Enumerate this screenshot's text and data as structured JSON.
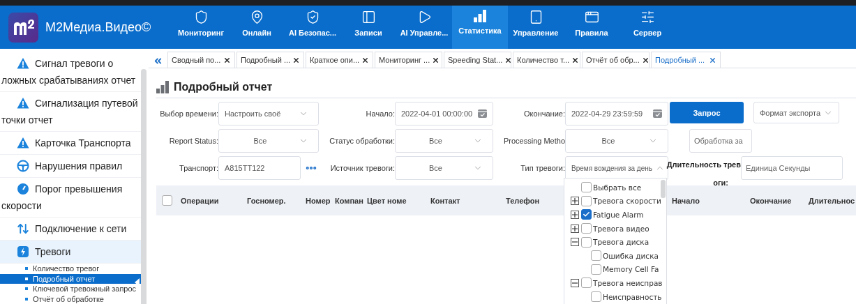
{
  "top_bar": {
    "brand": "M2Медиа.Видео©",
    "nav": [
      {
        "label": "Мониторинг",
        "selected": false
      },
      {
        "label": "Онлайн",
        "selected": false
      },
      {
        "label": "AI Безопас...",
        "selected": false
      },
      {
        "label": "Записи",
        "selected": false
      },
      {
        "label": "AI Управле...",
        "selected": false
      },
      {
        "label": "Статистика",
        "selected": true
      },
      {
        "label": "Управление",
        "selected": false
      },
      {
        "label": "Правила",
        "selected": false
      },
      {
        "label": "Сервер",
        "selected": false
      }
    ]
  },
  "sidebar": {
    "items": [
      {
        "label": "Сигнал тревоги о ложных срабатываниях отчет",
        "kind": "warning"
      },
      {
        "label": "Сигнализация путевой точки отчет",
        "kind": "warning"
      },
      {
        "label": "Карточка Транспорта",
        "kind": "warning"
      },
      {
        "label": "Нарушения правил",
        "kind": "wheel"
      },
      {
        "label": "Порог превышения скорости",
        "kind": "gauge"
      },
      {
        "label": "Подключение к сети",
        "kind": "arrows"
      },
      {
        "label": "Тревоги",
        "kind": "alarm",
        "expanded": true,
        "children": [
          {
            "label": "Количество тревог",
            "selected": false
          },
          {
            "label": "Подробный отчет",
            "selected": true
          },
          {
            "label": "Ключевой тревожный запрос",
            "selected": false
          },
          {
            "label": "Отчёт об обработке",
            "selected": false
          }
        ]
      }
    ]
  },
  "tabs": [
    {
      "label": "Сводный по...",
      "selected": false
    },
    {
      "label": "Подробный ...",
      "selected": false
    },
    {
      "label": "Краткое опи...",
      "selected": false
    },
    {
      "label": "Мониторинг ...",
      "selected": false
    },
    {
      "label": "Speeding Stat...",
      "selected": false
    },
    {
      "label": "Количество т...",
      "selected": false
    },
    {
      "label": "Отчёт об обр...",
      "selected": false
    },
    {
      "label": "Подробный ...",
      "selected": true
    }
  ],
  "page_title": "Подробный отчет",
  "filters": {
    "rows": [
      {
        "fields": [
          {
            "label": "Выбор времени:",
            "kind": "preset",
            "value": "Настроить своё"
          },
          {
            "label": "Начало:",
            "kind": "date",
            "value": "2022-04-01 00:00:00"
          },
          {
            "label": "Окончание:",
            "kind": "date",
            "value": "2022-04-29 23:59:59"
          }
        ],
        "extras": [
          {
            "kind": "primary",
            "label": "Запрос"
          },
          {
            "kind": "menu",
            "label": "Формат экспорта"
          }
        ]
      },
      {
        "fields": [
          {
            "label": "Report Status:",
            "kind": "select",
            "value": "Все"
          },
          {
            "label": "Статус обработки:",
            "kind": "select",
            "value": "Все"
          },
          {
            "label": "Processing Metho",
            "kind": "select",
            "value": "Все"
          }
        ],
        "extras": [
          {
            "kind": "input",
            "placeholder": "Обработка за"
          }
        ]
      },
      {
        "fields": [
          {
            "label": "Транспорт:",
            "kind": "picker",
            "value": "A815TT122"
          },
          {
            "label": "Источник тревоги:",
            "kind": "select",
            "value": "Все"
          },
          {
            "label": "Тип тревоги:",
            "kind": "tree-select",
            "value": "Время вождения за день",
            "expanded": true
          }
        ],
        "extras": [
          {
            "kind": "labeled-input",
            "label_lines": [
              "Длительность трев",
              "оги:"
            ],
            "placeholder": "Единица Секунды"
          }
        ]
      }
    ]
  },
  "table": {
    "select_all_checked": false,
    "columns": [
      "Операции",
      "Госномер.",
      "Номер",
      "Компан",
      "Цвет номе",
      "Контакт",
      "Телефон",
      "Начало",
      "Окончание",
      "Длительнос"
    ]
  },
  "dropdown": {
    "tree": [
      {
        "label": "Выбрать все",
        "checked": false
      },
      {
        "label": "Тревога скорости",
        "checked": false,
        "expanded": false
      },
      {
        "label": "Fatigue Alarm",
        "checked": true,
        "expanded": false
      },
      {
        "label": "Тревога видео",
        "checked": false,
        "expanded": false
      },
      {
        "label": "Тревога диска",
        "checked": false,
        "expanded": true,
        "children": [
          {
            "label": "Ошибка диска",
            "checked": false
          },
          {
            "label": "Memory Cell Fa",
            "checked": false
          }
        ]
      },
      {
        "label": "Тревога неисправ",
        "checked": false,
        "expanded": true,
        "children": [
          {
            "label": "Неисправность",
            "checked": false
          }
        ]
      }
    ]
  }
}
